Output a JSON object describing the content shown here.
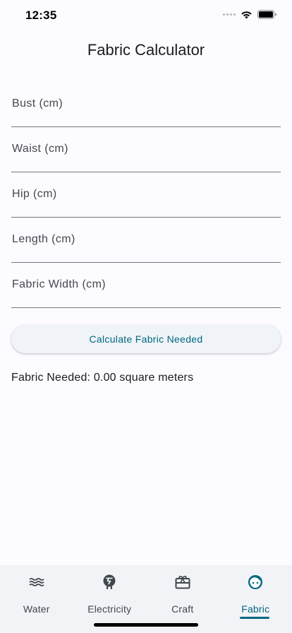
{
  "status_bar": {
    "time": "12:35"
  },
  "app_bar": {
    "title": "Fabric Calculator"
  },
  "form": {
    "fields": [
      {
        "placeholder": "Bust (cm)",
        "value": ""
      },
      {
        "placeholder": "Waist (cm)",
        "value": ""
      },
      {
        "placeholder": "Hip (cm)",
        "value": ""
      },
      {
        "placeholder": "Length (cm)",
        "value": ""
      },
      {
        "placeholder": "Fabric Width (cm)",
        "value": ""
      }
    ],
    "calculate_label": "Calculate Fabric Needed"
  },
  "result": {
    "text": "Fabric Needed: 0.00 square meters"
  },
  "bottom_nav": {
    "items": [
      {
        "label": "Water",
        "icon": "waves-icon"
      },
      {
        "label": "Electricity",
        "icon": "electric-meter-icon"
      },
      {
        "label": "Craft",
        "icon": "gift-card-icon"
      },
      {
        "label": "Fabric",
        "icon": "face-icon"
      }
    ],
    "active_index": 3
  },
  "colors": {
    "accent": "#006782",
    "background": "#fcfbff",
    "nav_background": "#f2f3f7",
    "button_background": "#f0f4f8"
  }
}
